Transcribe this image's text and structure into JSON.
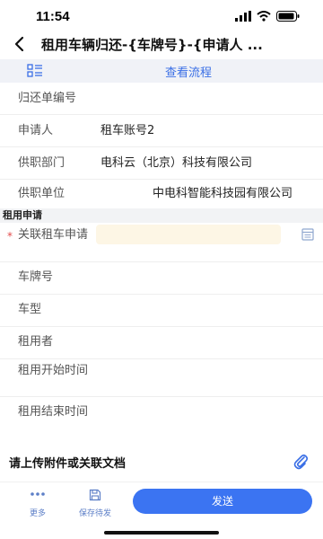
{
  "status": {
    "time": "11:54"
  },
  "nav": {
    "title": "租用车辆归还-{车牌号}-{申请人 ..."
  },
  "toolbar": {
    "flow_link": "查看流程"
  },
  "basic_fields": [
    {
      "label": "归还单编号",
      "value": ""
    },
    {
      "label": "申请人",
      "value": "租车账号2"
    },
    {
      "label": "供职部门",
      "value": "电科云（北京）科技有限公司"
    },
    {
      "label": "供职单位",
      "value": "中电科智能科技园有限公司"
    }
  ],
  "section": {
    "title": "租用申请"
  },
  "rental_fields": [
    {
      "label": "关联租车申请",
      "required": "*",
      "value": ""
    },
    {
      "label": "车牌号",
      "value": ""
    },
    {
      "label": "车型",
      "value": ""
    },
    {
      "label": "租用者",
      "value": ""
    },
    {
      "label": "租用开始时间",
      "value": ""
    },
    {
      "label": "租用结束时间",
      "value": ""
    }
  ],
  "attachments": {
    "label": "请上传附件或关联文档"
  },
  "bottom": {
    "more_label": "更多",
    "save_label": "保存待发",
    "send_label": "发送"
  },
  "colors": {
    "accent": "#3b74f2",
    "required": "#e34b4b",
    "input_bg": "#fdf6e5"
  },
  "icons": [
    "back-icon",
    "list-icon",
    "picker-icon",
    "paperclip-icon",
    "more-icon",
    "save-icon"
  ]
}
